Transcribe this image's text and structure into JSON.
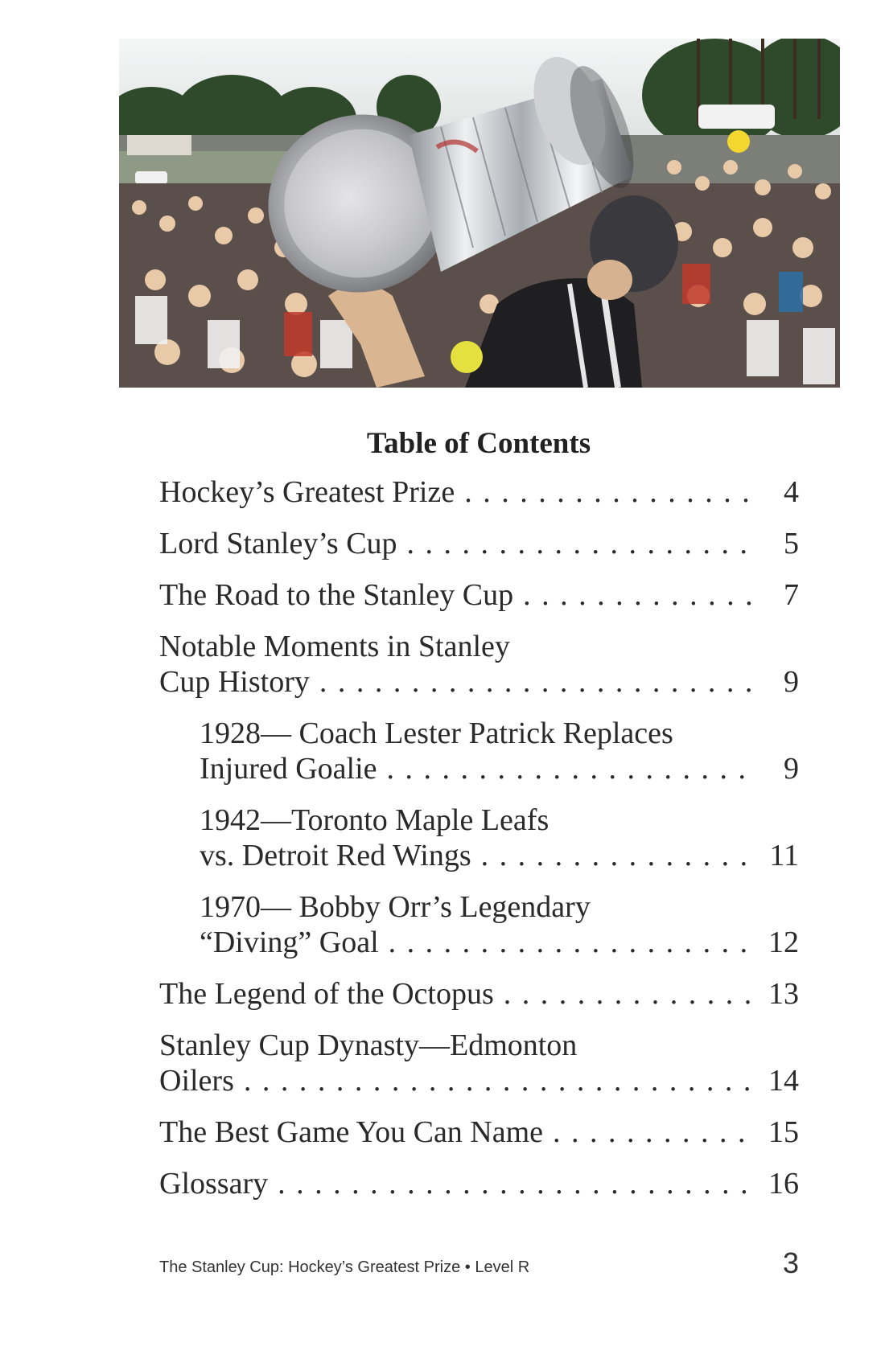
{
  "photo": {
    "description_icon": "stanley-cup-celebration-photo"
  },
  "toc": {
    "title": "Table of Contents",
    "entries": [
      {
        "lines": [
          "Hockey’s Greatest Prize"
        ],
        "page": "4",
        "indent": false
      },
      {
        "lines": [
          "Lord Stanley’s Cup"
        ],
        "page": "5",
        "indent": false
      },
      {
        "lines": [
          "The Road to the Stanley Cup"
        ],
        "page": "7",
        "indent": false
      },
      {
        "lines": [
          "Notable Moments in Stanley",
          "Cup History"
        ],
        "page": "9",
        "indent": false
      },
      {
        "lines": [
          "1928— Coach Lester Patrick Replaces",
          "Injured Goalie"
        ],
        "page": "9",
        "indent": true
      },
      {
        "lines": [
          "1942—Toronto Maple Leafs",
          "vs. Detroit Red Wings"
        ],
        "page": "11",
        "indent": true
      },
      {
        "lines": [
          "1970— Bobby Orr’s Legendary",
          "“Diving” Goal"
        ],
        "page": "12",
        "indent": true
      },
      {
        "lines": [
          "The Legend of the Octopus"
        ],
        "page": "13",
        "indent": false
      },
      {
        "lines": [
          "Stanley Cup Dynasty—Edmonton",
          "Oilers"
        ],
        "page": "14",
        "indent": false
      },
      {
        "lines": [
          "The Best Game You Can Name"
        ],
        "page": "15",
        "indent": false
      },
      {
        "lines": [
          "Glossary"
        ],
        "page": "16",
        "indent": false
      }
    ]
  },
  "footer": {
    "text": "The Stanley Cup: Hockey’s Greatest Prize • Level R",
    "page_number": "3"
  }
}
